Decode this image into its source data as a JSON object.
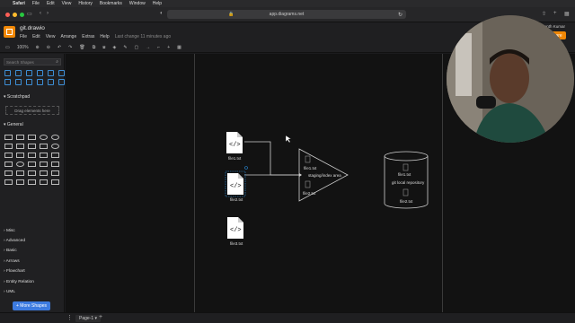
{
  "mac_menu": {
    "items": [
      "Safari",
      "File",
      "Edit",
      "View",
      "History",
      "Bookmarks",
      "Window",
      "Help"
    ]
  },
  "browser": {
    "url": "app.diagrams.net"
  },
  "app": {
    "doc_name": "git.drawio",
    "menu": [
      "File",
      "Edit",
      "View",
      "Arrange",
      "Extras",
      "Help"
    ],
    "saved_status": "Last change 11 minutes ago",
    "zoom": "100%",
    "user": "Srikanth Kumar",
    "share_label": "Share"
  },
  "sidebar": {
    "search_placeholder": "Search Shapes",
    "scratchpad": "Scratchpad",
    "drag_hint": "Drag elements here",
    "general": "General",
    "categories": [
      "Misc",
      "Advanced",
      "Basic",
      "Arrows",
      "Flowchart",
      "Entity Relation",
      "UML"
    ],
    "more_shapes": "More Shapes"
  },
  "diagram": {
    "files": [
      "file1.txt",
      "file2.txt",
      "file3.txt"
    ],
    "staging_label": "staging/index area",
    "staging_files": [
      "file1.txt",
      "file2.txt"
    ],
    "repo_label": "git local repository",
    "repo_files": [
      "file1.txt",
      "file2.txt"
    ]
  },
  "footer": {
    "page_tab": "Page-1"
  },
  "colors": {
    "accent": "#f08705",
    "primary_button": "#3d7be0",
    "selection": "#2a8fe0"
  }
}
